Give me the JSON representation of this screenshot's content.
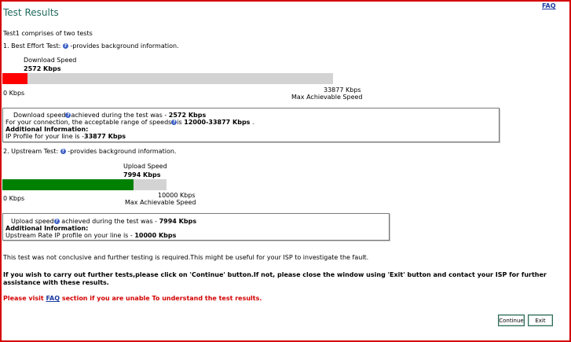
{
  "header": {
    "title": "Test Results",
    "faq_link": "FAQ"
  },
  "intro": "Test1 comprises of two tests",
  "download": {
    "heading_pre": "1. Best Effort Test: ",
    "heading_post": " -provides background information.",
    "speed_label": "Download Speed",
    "speed_value": "2572 Kbps",
    "fill_fraction": 0.0759,
    "fill_color": "#ff0000",
    "min_label": "0 Kbps",
    "max_value": "33877 Kbps",
    "max_label": "Max Achievable Speed",
    "box": {
      "line1_pre": "Download speed",
      "line1_mid": "achieved during the test was - ",
      "line1_value": "2572 Kbps",
      "line2_pre": "For your connection, the acceptable range of speeds",
      "line2_mid": "is ",
      "line2_value": "12000-33877 Kbps",
      "line2_post": " .",
      "additional_title": "Additional Information:",
      "line4_pre": "IP Profile for your line is -",
      "line4_value": "33877 Kbps"
    }
  },
  "upload": {
    "heading_pre": "2. Upstream Test: ",
    "heading_post": " -provides background information.",
    "speed_label": "Upload Speed",
    "speed_value": "7994 Kbps",
    "fill_fraction": 0.7994,
    "fill_color": "#008000",
    "min_label": "0 Kbps",
    "max_value": "10000 Kbps",
    "max_label": "Max Achievable Speed",
    "box": {
      "line1_pre": "Upload speed",
      "line1_mid": " achieved during the test was - ",
      "line1_value": "7994 Kbps",
      "additional_title": "Additional Information:",
      "line3_pre": "Upstream Rate IP profile on your line is - ",
      "line3_value": "10000 Kbps"
    }
  },
  "conclusion": "This test was not conclusive and further testing is required.This might be useful for your ISP to investigate the fault.",
  "instruction": "If you wish to carry out further tests,please click on 'Continue' button.If not, please close the window using 'Exit' button and contact your ISP for further assistance with these results.",
  "visit": {
    "pre": "Please visit ",
    "link": "FAQ",
    "post": " section if you are unable To understand the test results."
  },
  "buttons": {
    "continue": "Continue",
    "exit": "Exit"
  },
  "icons": {
    "info": "info-icon"
  }
}
